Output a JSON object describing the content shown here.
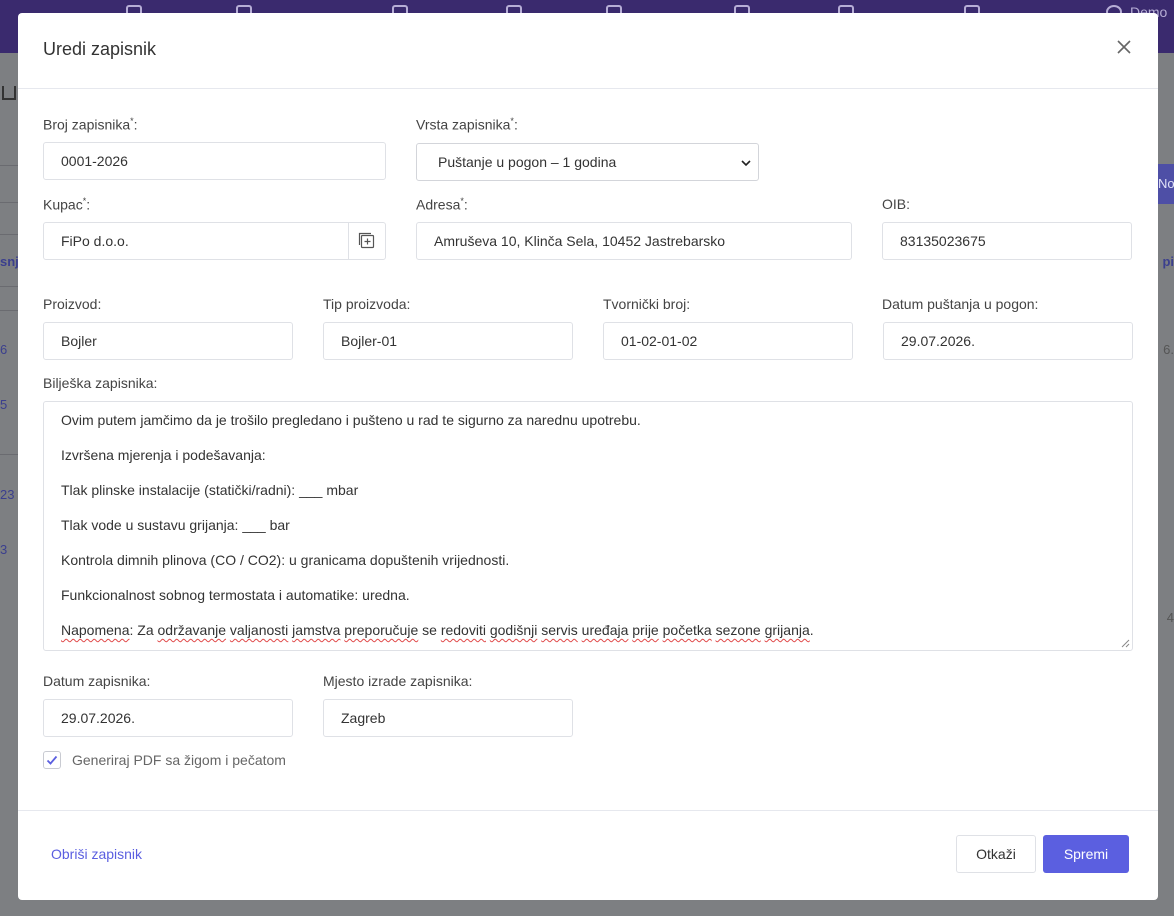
{
  "background": {
    "left_fragments": [
      "snj",
      "6",
      "5",
      "23",
      "3"
    ],
    "right_fragments": [
      "pi",
      "6.",
      "4"
    ],
    "right_button_label": "No",
    "nav_right_label": "Demo"
  },
  "modal": {
    "title": "Uredi zapisnik",
    "fields": {
      "broj_zapisnika": {
        "label": "Broj zapisnika",
        "required_mark": "*",
        "suffix": ":",
        "value": "0001-2026"
      },
      "vrsta_zapisnika": {
        "label": "Vrsta zapisnika",
        "required_mark": "*",
        "suffix": ":",
        "value": "Puštanje u pogon – 1 godina"
      },
      "kupac": {
        "label": "Kupac",
        "required_mark": "*",
        "suffix": ":",
        "value": "FiPo d.o.o."
      },
      "adresa": {
        "label": "Adresa",
        "required_mark": "*",
        "suffix": ":",
        "value": "Amruševa 10, Klinča Sela, 10452 Jastrebarsko"
      },
      "oib": {
        "label": "OIB:",
        "value": "83135023675"
      },
      "proizvod": {
        "label": "Proizvod:",
        "value": "Bojler"
      },
      "tip_proizvoda": {
        "label": "Tip proizvoda:",
        "value": "Bojler-01"
      },
      "tvornicki_broj": {
        "label": "Tvornički broj:",
        "value": "01-02-01-02"
      },
      "datum_pustanja": {
        "label": "Datum puštanja u pogon:",
        "value": "29.07.2026."
      },
      "biljeska": {
        "label": "Bilješka zapisnika:",
        "lines": [
          "Ovim putem jamčimo da je trošilo pregledano i pušteno u rad te sigurno za narednu upotrebu.",
          "Izvršena mjerenja i podešavanja:",
          "Tlak plinske instalacije (statički/radni): ___ mbar",
          "Tlak vode u sustavu grijanja: ___ bar",
          "Kontrola dimnih plinova (CO / CO2): u granicama dopuštenih vrijednosti.",
          "Funkcionalnost sobnog termostata i automatike: uredna."
        ],
        "last_line": {
          "w1": "Napomena",
          "t1": ": Za ",
          "w2": "održavanje",
          "t2": " ",
          "w3": "valjanosti",
          "t3": " ",
          "w4": "jamstva",
          "t4": " ",
          "w5": "preporučuje",
          "t5": " se ",
          "w6": "redoviti",
          "t6": " ",
          "w7": "godišnji",
          "t7": " ",
          "w8": "servis",
          "t8": " ",
          "w9": "uređaja",
          "t9": " ",
          "w10": "prije",
          "t10": " ",
          "w11": "početka",
          "t11": " ",
          "w12": "sezone",
          "t12": " ",
          "w13": "grijanja",
          "t13": "."
        }
      },
      "datum_zapisnika": {
        "label": "Datum zapisnika:",
        "value": "29.07.2026."
      },
      "mjesto_izrade": {
        "label": "Mjesto izrade zapisnika:",
        "value": "Zagreb"
      }
    },
    "checkbox": {
      "label": "Generiraj PDF sa žigom i pečatom",
      "checked": true
    },
    "footer": {
      "delete_label": "Obriši zapisnik",
      "cancel_label": "Otkaži",
      "save_label": "Spremi"
    }
  },
  "colors": {
    "primary": "#5b5fe0",
    "topbar": "#3a2a6e",
    "overlay": "#7d7f82",
    "spellcheck": "#e04848"
  }
}
